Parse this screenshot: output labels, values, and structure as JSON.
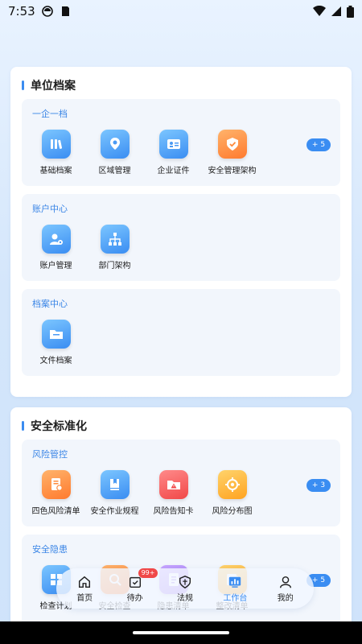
{
  "status": {
    "time": "7:53"
  },
  "cards": [
    {
      "title": "单位档案",
      "groups": [
        {
          "title": "一企一档",
          "items": [
            {
              "label": "基础档案",
              "icon": "books-icon"
            },
            {
              "label": "区域管理",
              "icon": "location-icon"
            },
            {
              "label": "企业证件",
              "icon": "id-card-icon"
            },
            {
              "label": "安全管理架构",
              "icon": "shield-icon"
            }
          ],
          "more": "+ 5"
        },
        {
          "title": "账户中心",
          "items": [
            {
              "label": "账户管理",
              "icon": "user-gear-icon"
            },
            {
              "label": "部门架构",
              "icon": "org-chart-icon"
            }
          ]
        },
        {
          "title": "档案中心",
          "items": [
            {
              "label": "文件档案",
              "icon": "folder-icon"
            }
          ]
        }
      ]
    },
    {
      "title": "安全标准化",
      "groups": [
        {
          "title": "风险管控",
          "items": [
            {
              "label": "四色风险清单",
              "icon": "document-list-icon"
            },
            {
              "label": "安全作业规程",
              "icon": "book-icon"
            },
            {
              "label": "风险告知卡",
              "icon": "warning-folder-icon"
            },
            {
              "label": "风险分布图",
              "icon": "target-icon"
            }
          ],
          "more": "+ 3"
        },
        {
          "title": "安全隐患",
          "items": [
            {
              "label": "检查计划",
              "icon": "grid-icon"
            },
            {
              "label": "安全检查",
              "icon": "search-icon"
            },
            {
              "label": "隐患清单",
              "icon": "list-icon"
            },
            {
              "label": "整改清单",
              "icon": "edit-icon"
            }
          ],
          "more": "+ 5"
        }
      ]
    }
  ],
  "tabbar": {
    "tabs": [
      {
        "label": "首页",
        "icon": "home-icon"
      },
      {
        "label": "待办",
        "icon": "todo-icon",
        "badge": "99+"
      },
      {
        "label": "法规",
        "icon": "law-shield-icon"
      },
      {
        "label": "工作台",
        "icon": "workbench-icon",
        "active": true
      },
      {
        "label": "我的",
        "icon": "person-icon"
      }
    ]
  },
  "colors": {
    "accent": "#3a8df2",
    "badge": "#f04848"
  }
}
